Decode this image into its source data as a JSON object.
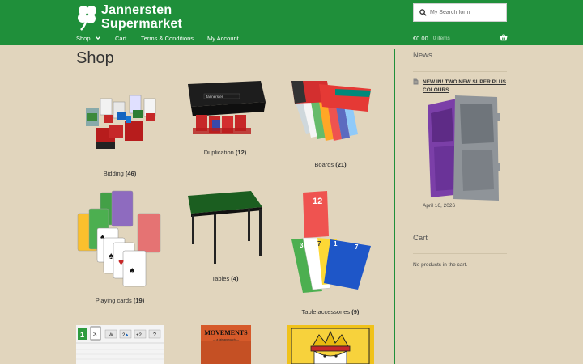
{
  "header": {
    "logo_line1": "Jannersten",
    "logo_line2": "Supermarket",
    "search_placeholder": "My Search form",
    "cart_total": "€0.00",
    "cart_items": "0 items"
  },
  "nav": {
    "items": [
      {
        "label": "Shop"
      },
      {
        "label": "Cart"
      },
      {
        "label": "Terms & Conditions"
      },
      {
        "label": "My Account"
      }
    ]
  },
  "main": {
    "title": "Shop",
    "categories": [
      {
        "name": "Bidding",
        "count": "(46)"
      },
      {
        "name": "Duplication",
        "count": "(12)"
      },
      {
        "name": "Boards",
        "count": "(21)"
      },
      {
        "name": "Playing cards",
        "count": "(19)"
      },
      {
        "name": "Tables",
        "count": "(4)"
      },
      {
        "name": "Table accessories",
        "count": "(9)"
      }
    ],
    "partial_products": {
      "movements_title": "MOVEMENTS",
      "movements_sub": "— a fair approach —",
      "bidding_box_values": [
        "1",
        "3",
        "W",
        "2",
        "+2",
        "?"
      ]
    }
  },
  "sidebar": {
    "news_heading": "News",
    "news_link": "NEW IN! TWO NEW SUPER PLUS COLOURS",
    "news_date": "April 16, 2026",
    "cart_heading": "Cart",
    "cart_empty": "No products in the cart."
  },
  "colors": {
    "brand_green": "#1f8f3a",
    "background": "#e1d5bd"
  }
}
